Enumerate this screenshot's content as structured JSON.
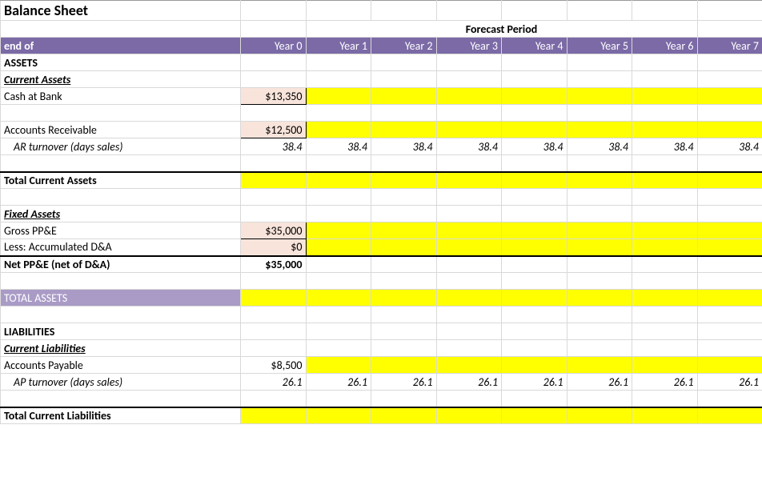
{
  "title": "Balance Sheet",
  "forecastHeader": "Forecast Period",
  "headerRow": {
    "label": "end of",
    "years": [
      "Year 0",
      "Year 1",
      "Year 2",
      "Year 3",
      "Year 4",
      "Year 5",
      "Year 6",
      "Year 7"
    ]
  },
  "sections": {
    "assets": "ASSETS",
    "currentAssets": "Current Assets",
    "cashAtBank": {
      "label": "Cash at Bank",
      "y0": "$13,350"
    },
    "accountsReceivable": {
      "label": "Accounts Receivable",
      "y0": "$12,500"
    },
    "arTurnover": {
      "label": "AR turnover (days sales)",
      "vals": [
        "38.4",
        "38.4",
        "38.4",
        "38.4",
        "38.4",
        "38.4",
        "38.4",
        "38.4"
      ]
    },
    "totalCurrentAssets": "Total Current Assets",
    "fixedAssets": "Fixed Assets",
    "grossPPE": {
      "label": "Gross PP&E",
      "y0": "$35,000"
    },
    "lessDA": {
      "label": "Less: Accumulated D&A",
      "y0": "$0"
    },
    "netPPE": {
      "label": "Net PP&E (net of D&A)",
      "y0": "$35,000"
    },
    "totalAssets": "TOTAL ASSETS",
    "liabilities": "LIABILITIES",
    "currentLiabilities": "Current Liabilities",
    "accountsPayable": {
      "label": "Accounts Payable",
      "y0": "$8,500"
    },
    "apTurnover": {
      "label": "AP turnover (days sales)",
      "vals": [
        "26.1",
        "26.1",
        "26.1",
        "26.1",
        "26.1",
        "26.1",
        "26.1",
        "26.1"
      ]
    },
    "totalCurrentLiabilities": "Total Current Liabilities"
  },
  "chart_data": {
    "type": "table",
    "title": "Balance Sheet — Forecast Period",
    "columns": [
      "Year 0",
      "Year 1",
      "Year 2",
      "Year 3",
      "Year 4",
      "Year 5",
      "Year 6",
      "Year 7"
    ],
    "rows": [
      {
        "label": "Cash at Bank",
        "values": [
          13350,
          null,
          null,
          null,
          null,
          null,
          null,
          null
        ],
        "unit": "$"
      },
      {
        "label": "Accounts Receivable",
        "values": [
          12500,
          null,
          null,
          null,
          null,
          null,
          null,
          null
        ],
        "unit": "$"
      },
      {
        "label": "AR turnover (days sales)",
        "values": [
          38.4,
          38.4,
          38.4,
          38.4,
          38.4,
          38.4,
          38.4,
          38.4
        ],
        "unit": "days"
      },
      {
        "label": "Total Current Assets",
        "values": [
          null,
          null,
          null,
          null,
          null,
          null,
          null,
          null
        ]
      },
      {
        "label": "Gross PP&E",
        "values": [
          35000,
          null,
          null,
          null,
          null,
          null,
          null,
          null
        ],
        "unit": "$"
      },
      {
        "label": "Less: Accumulated D&A",
        "values": [
          0,
          null,
          null,
          null,
          null,
          null,
          null,
          null
        ],
        "unit": "$"
      },
      {
        "label": "Net PP&E (net of D&A)",
        "values": [
          35000,
          null,
          null,
          null,
          null,
          null,
          null,
          null
        ],
        "unit": "$"
      },
      {
        "label": "TOTAL ASSETS",
        "values": [
          null,
          null,
          null,
          null,
          null,
          null,
          null,
          null
        ]
      },
      {
        "label": "Accounts Payable",
        "values": [
          8500,
          null,
          null,
          null,
          null,
          null,
          null,
          null
        ],
        "unit": "$"
      },
      {
        "label": "AP turnover (days sales)",
        "values": [
          26.1,
          26.1,
          26.1,
          26.1,
          26.1,
          26.1,
          26.1,
          26.1
        ],
        "unit": "days"
      },
      {
        "label": "Total Current Liabilities",
        "values": [
          null,
          null,
          null,
          null,
          null,
          null,
          null,
          null
        ]
      }
    ]
  }
}
